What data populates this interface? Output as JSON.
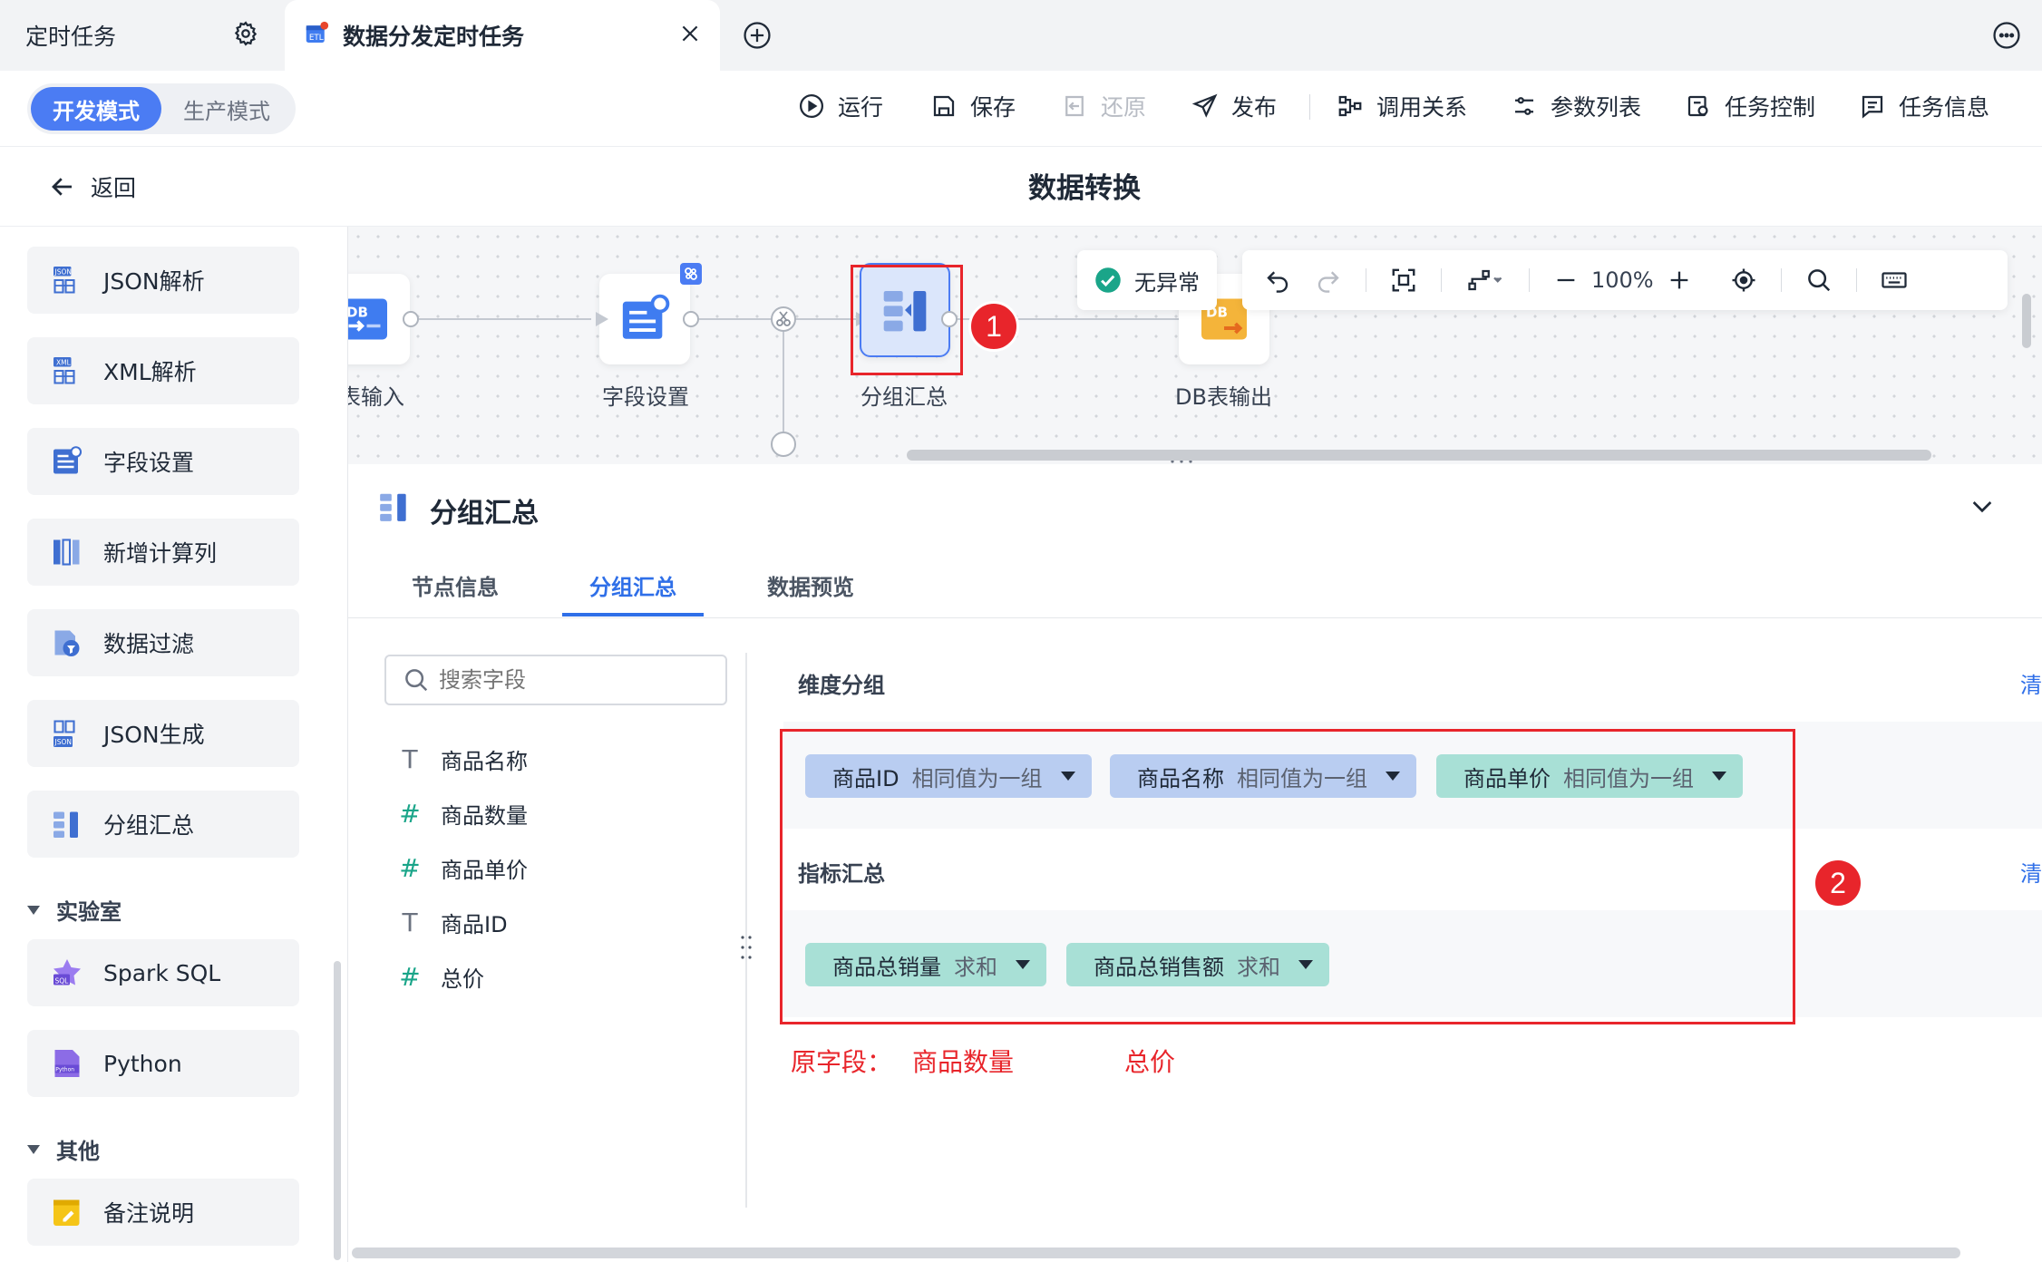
{
  "tabs": {
    "inactive_label": "定时任务",
    "active_label": "数据分发定时任务"
  },
  "toolbar": {
    "modes": [
      "开发模式",
      "生产模式"
    ],
    "run": "运行",
    "save": "保存",
    "restore": "还原",
    "publish": "发布",
    "call_relation": "调用关系",
    "param_list": "参数列表",
    "task_control": "任务控制",
    "task_info": "任务信息"
  },
  "header": {
    "back": "返回",
    "title": "数据转换"
  },
  "sidebar": {
    "items": [
      {
        "label": "JSON解析",
        "icon": "json-parse-icon"
      },
      {
        "label": "XML解析",
        "icon": "xml-parse-icon"
      },
      {
        "label": "字段设置",
        "icon": "field-settings-icon"
      },
      {
        "label": "新增计算列",
        "icon": "calc-column-icon"
      },
      {
        "label": "数据过滤",
        "icon": "data-filter-icon"
      },
      {
        "label": "JSON生成",
        "icon": "json-generate-icon"
      },
      {
        "label": "分组汇总",
        "icon": "group-summary-icon"
      }
    ],
    "lab_section": "实验室",
    "lab_items": [
      {
        "label": "Spark SQL",
        "icon": "spark-sql-icon"
      },
      {
        "label": "Python",
        "icon": "python-icon"
      }
    ],
    "other_section": "其他",
    "other_items": [
      {
        "label": "备注说明",
        "icon": "note-icon"
      }
    ]
  },
  "canvas": {
    "nodes": [
      {
        "label": "表输入",
        "icon_text": "DB"
      },
      {
        "label": "字段设置"
      },
      {
        "label": "分组汇总"
      },
      {
        "label": "DB表输出",
        "icon_text": "DB"
      }
    ],
    "status": "无异常",
    "zoom": "100%"
  },
  "annotations": {
    "badge1": "1",
    "badge2": "2",
    "note_prefix": "原字段：",
    "note_field1": "商品数量",
    "note_field2": "总价"
  },
  "panel": {
    "title": "分组汇总",
    "tabs": [
      "节点信息",
      "分组汇总",
      "数据预览"
    ],
    "search_placeholder": "搜索字段",
    "fields": [
      {
        "type": "T",
        "name": "商品名称"
      },
      {
        "type": "#",
        "name": "商品数量"
      },
      {
        "type": "#",
        "name": "商品单价"
      },
      {
        "type": "T",
        "name": "商品ID"
      },
      {
        "type": "#",
        "name": "总价"
      }
    ],
    "dimension_label": "维度分组",
    "metric_label": "指标汇总",
    "clear_label": "清",
    "dimensions": [
      {
        "name": "商品ID",
        "mode": "相同值为一组",
        "color": "#b9cdf1"
      },
      {
        "name": "商品名称",
        "mode": "相同值为一组",
        "color": "#b9cdf1"
      },
      {
        "name": "商品单价",
        "mode": "相同值为一组",
        "color": "#a8e0d6"
      }
    ],
    "metrics": [
      {
        "name": "商品总销量",
        "agg": "求和",
        "color": "#a8e0d6"
      },
      {
        "name": "商品总销售额",
        "agg": "求和",
        "color": "#a8e0d6"
      }
    ]
  },
  "colors": {
    "accent": "#4b7cf3",
    "link": "#2f6fe8",
    "annotation_red": "#e8252b",
    "success": "#1aa589"
  }
}
